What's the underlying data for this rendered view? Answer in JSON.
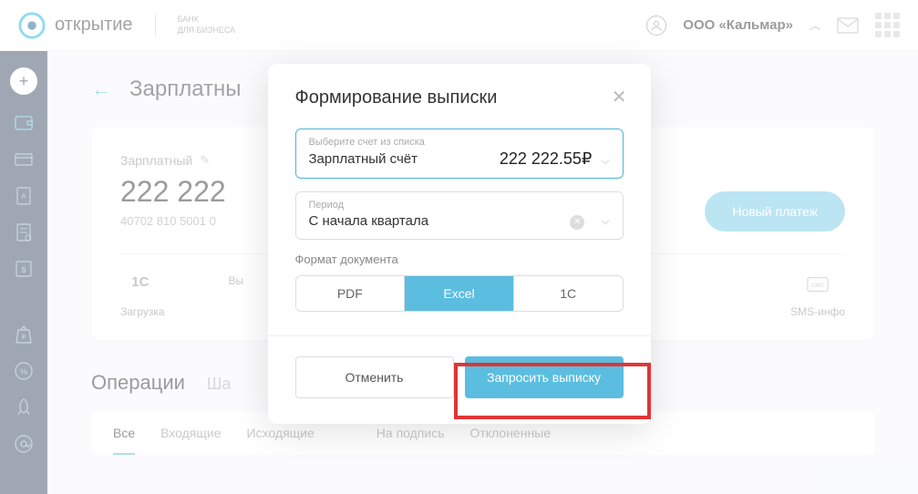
{
  "header": {
    "brand": "открытие",
    "sub1": "БАНК",
    "sub2": "ДЛЯ БИЗНЕСА",
    "user": "ООО «Кальмар»"
  },
  "page": {
    "title": "Зарплатны",
    "account_label": "Зарплатный",
    "balance": "222 222",
    "account_num": "40702 810 5001 0",
    "new_payment": "Новый платеж",
    "actions": {
      "upload": "Загрузка",
      "statement": "Вы",
      "sms": "SMS-инфо"
    }
  },
  "section": {
    "title": "Операции",
    "sub": "Ша"
  },
  "filters": {
    "all": "Все",
    "in": "Входящие",
    "out": "Исходящие",
    "sign": "На подпись",
    "rej": "Отклоненные"
  },
  "modal": {
    "title": "Формирование выписки",
    "account_field_label": "Выберите счет из списка",
    "account_field_value": "Зарплатный счёт",
    "account_amount": "222 222.55₽",
    "period_label": "Период",
    "period_value": "С начала квартала",
    "format_label": "Формат документа",
    "formats": {
      "pdf": "PDF",
      "excel": "Excel",
      "onec": "1C"
    },
    "cancel": "Отменить",
    "submit": "Запросить выписку"
  }
}
